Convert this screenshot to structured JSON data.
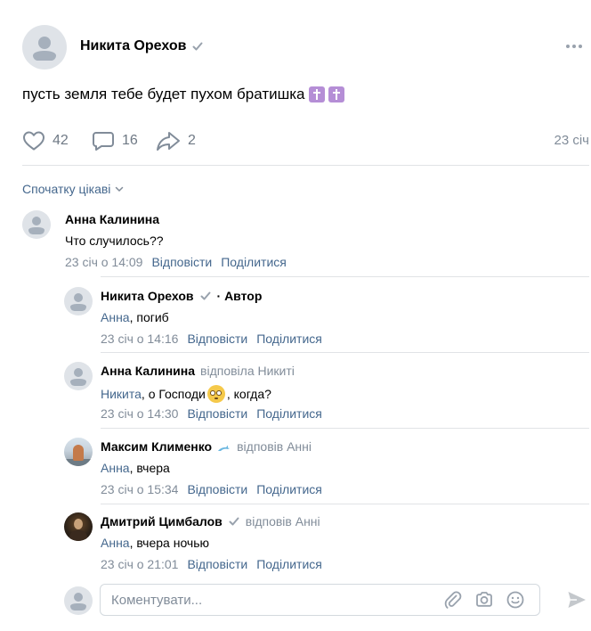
{
  "post": {
    "author": "Никита Орехов",
    "text": "пусть земля тебе будет пухом братишка",
    "likes": "42",
    "comments": "16",
    "shares": "2",
    "date": "23 січ"
  },
  "sort_label": "Спочатку цікаві",
  "comments": [
    {
      "name": "Анна Калинина",
      "text": "Что случилось??",
      "time": "23 січ о 14:09",
      "reply": "Відповісти",
      "share": "Поділитися"
    },
    {
      "name": "Никита Орехов",
      "author_tag": "· Автор",
      "mention": "Анна",
      "text": ", погиб",
      "time": "23 січ о 14:16",
      "reply": "Відповісти",
      "share": "Поділитися"
    },
    {
      "name": "Анна Калинина",
      "reply_to": "відповіла Никиті",
      "mention": "Никита",
      "text_before": ", о Господи",
      "text_after": ", когда?",
      "time": "23 січ о 14:30",
      "reply": "Відповісти",
      "share": "Поділитися"
    },
    {
      "name": "Максим Клименко",
      "reply_to": "відповів Анні",
      "mention": "Анна",
      "text": ", вчера",
      "time": "23 січ о 15:34",
      "reply": "Відповісти",
      "share": "Поділитися"
    },
    {
      "name": "Дмитрий Цимбалов",
      "reply_to": "відповів Анні",
      "mention": "Анна",
      "text": ", вчера ночью",
      "time": "23 січ о 21:01",
      "reply": "Відповісти",
      "share": "Поділитися"
    }
  ],
  "composer": {
    "placeholder": "Коментувати..."
  },
  "icons": {
    "like": "heart-icon",
    "comment": "comment-bubble-icon",
    "share": "share-arrow-icon",
    "verified": "checkmark-icon",
    "more": "more-dots-icon",
    "attach": "paperclip-icon",
    "camera": "camera-icon",
    "emoji": "smiley-icon",
    "send": "send-icon"
  },
  "colors": {
    "link": "#44678d",
    "secondary": "#818c99",
    "icon": "#99a2ad",
    "divider": "#e1e3e6"
  }
}
